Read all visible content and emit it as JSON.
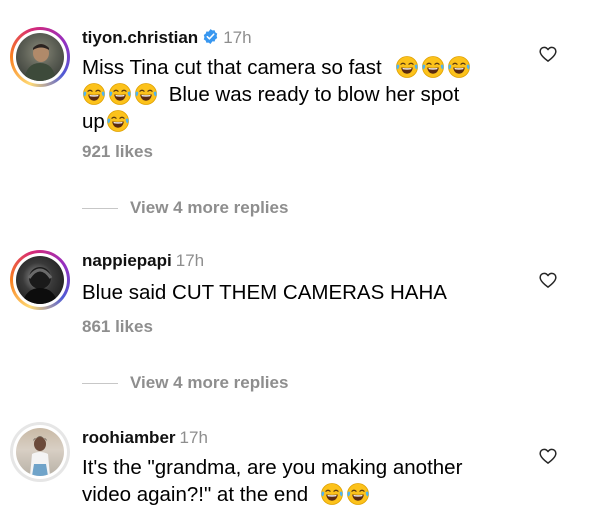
{
  "comments": [
    {
      "username": "tiyon.christian",
      "verified": true,
      "time": "17h",
      "text_line1": "Miss Tina cut that camera so fast",
      "text_line2": "Blue was ready to blow her spot",
      "text_line3": "up",
      "likes": "921 likes",
      "replies": "View 4 more replies"
    },
    {
      "username": "nappiepapi",
      "verified": false,
      "time": "17h",
      "text_line1": "Blue said CUT THEM CAMERAS HAHA",
      "likes": "861 likes",
      "replies": "View 4 more replies"
    },
    {
      "username": "roohiamber",
      "verified": false,
      "time": "17h",
      "text_line1": "It's the \"grandma, are you making another",
      "text_line2": "video again?!\" at the end"
    }
  ],
  "icons": {
    "like": "heart-outline-icon",
    "verified": "verified-badge-icon",
    "emoji": "face-with-tears-of-joy-emoji"
  },
  "colors": {
    "verified_blue": "#3897f0",
    "secondary_text": "#8e8e8e",
    "emoji_yellow": "#fcc21b"
  }
}
